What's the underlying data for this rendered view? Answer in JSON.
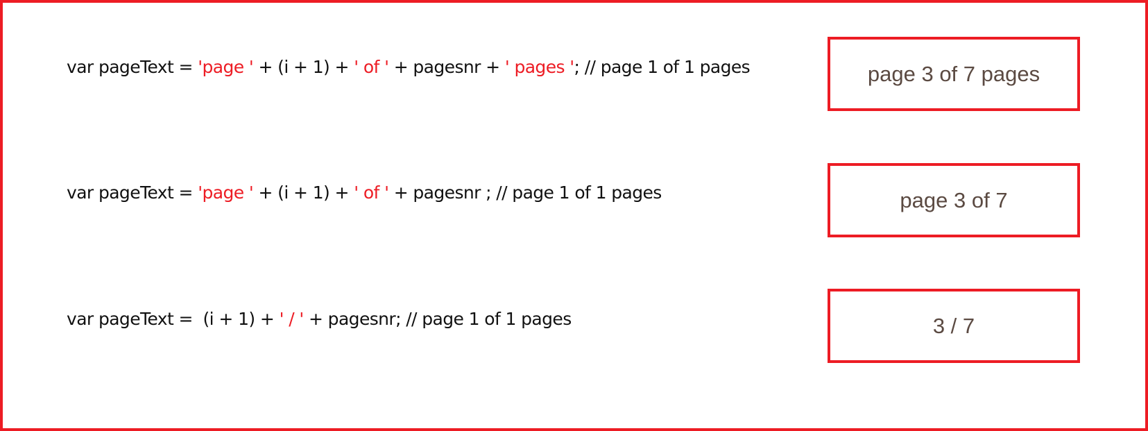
{
  "colors": {
    "frame_border": "#ed1c24",
    "string_literal": "#ed1c24",
    "code_text": "#111111",
    "result_text": "#5b4a42"
  },
  "examples": [
    {
      "code": {
        "decl": "var pageText = ",
        "s1": "'page '",
        "p1": " + (i + 1) + ",
        "s2": "' of '",
        "p2": " + pagesnr + ",
        "s3": "' pages '",
        "p3": "; // page 1 of 1 pages"
      },
      "result": "page 3 of 7 pages"
    },
    {
      "code": {
        "decl": "var pageText = ",
        "s1": "'page '",
        "p1": " + (i + 1) + ",
        "s2": "' of '",
        "p2": " + pagesnr ; // page 1 of 1 pages"
      },
      "result": "page 3 of 7"
    },
    {
      "code": {
        "decl": "var pageText =  (i + 1) + ",
        "s1": "' / '",
        "p1": " + pagesnr; // page 1 of 1 pages"
      },
      "result": "3 / 7"
    }
  ]
}
